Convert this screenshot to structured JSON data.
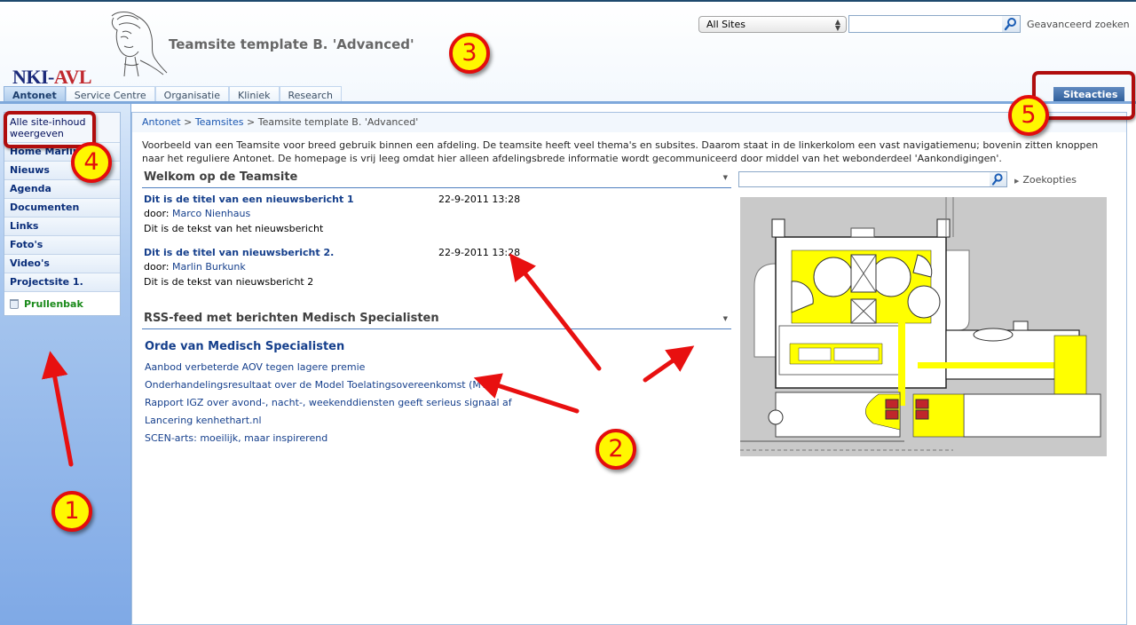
{
  "header": {
    "logo": {
      "part1": "NKI-",
      "part2": "AVL"
    },
    "site_title": "Teamsite template B. 'Advanced'",
    "search": {
      "scope_selected": "All Sites",
      "query_value": "",
      "advanced_label": "Geavanceerd zoeken"
    },
    "tabs": [
      {
        "label": "Antonet",
        "active": true
      },
      {
        "label": "Service Centre",
        "active": false
      },
      {
        "label": "Organisatie",
        "active": false
      },
      {
        "label": "Kliniek",
        "active": false
      },
      {
        "label": "Research",
        "active": false
      }
    ],
    "site_actions_label": "Siteacties"
  },
  "quick_launch": {
    "view_all_label": "Alle site-inhoud weergeven",
    "items": [
      {
        "label": "Home Marlin"
      },
      {
        "label": "Nieuws"
      },
      {
        "label": "Agenda"
      },
      {
        "label": "Documenten"
      },
      {
        "label": "Links"
      },
      {
        "label": "Foto's"
      },
      {
        "label": "Video's"
      },
      {
        "label": "Projectsite 1."
      }
    ],
    "recycle_bin_label": "Prullenbak"
  },
  "breadcrumb": {
    "items": [
      "Antonet",
      "Teamsites",
      "Teamsite template B. 'Advanced'"
    ],
    "separator": " > "
  },
  "description": "Voorbeeld van een Teamsite voor breed gebruik binnen een afdeling. De teamsite heeft veel thema's en subsites. Daarom staat in de linkerkolom een vast navigatiemenu; bovenin zitten knoppen naar het reguliere Antonet. De homepage is vrij leeg omdat hier alleen afdelingsbrede informatie wordt gecommuniceerd door middel van het webonderdeel 'Aankondigingen'.",
  "welcome_webpart": {
    "title": "Welkom op de Teamsite",
    "news": [
      {
        "title": "Dit is de titel van een nieuwsbericht 1",
        "date": "22-9-2011 13:28",
        "by_label": "door:",
        "author": "Marco Nienhaus",
        "body": "Dit is de tekst van het nieuwsbericht"
      },
      {
        "title": "Dit is de titel van nieuwsbericht 2.",
        "date": "22-9-2011 13:28",
        "by_label": "door:",
        "author": "Marlin Burkunk",
        "body": "Dit is de tekst van nieuwsbericht 2"
      }
    ]
  },
  "rss_webpart": {
    "title": "RSS-feed met berichten Medisch Specialisten",
    "feed_title": "Orde van Medisch Specialisten",
    "items": [
      "Aanbod verbeterde AOV tegen lagere premie",
      "Onderhandelingsresultaat over de Model Toelatingsovereenkomst (MTO)",
      "Rapport IGZ over avond-, nacht-, weekenddiensten geeft serieus signaal af",
      "Lancering kenhethart.nl",
      "SCEN-arts: moeilijk, maar inspirerend"
    ]
  },
  "side_search": {
    "query_value": "",
    "options_label": "Zoekopties"
  },
  "image": {
    "alt": "floor-plan"
  },
  "annotations": {
    "callouts": [
      "1",
      "2",
      "3",
      "4",
      "5"
    ],
    "color_fill": "#fff700",
    "color_ring": "#e30d0d",
    "arrow_color": "#e81010"
  }
}
